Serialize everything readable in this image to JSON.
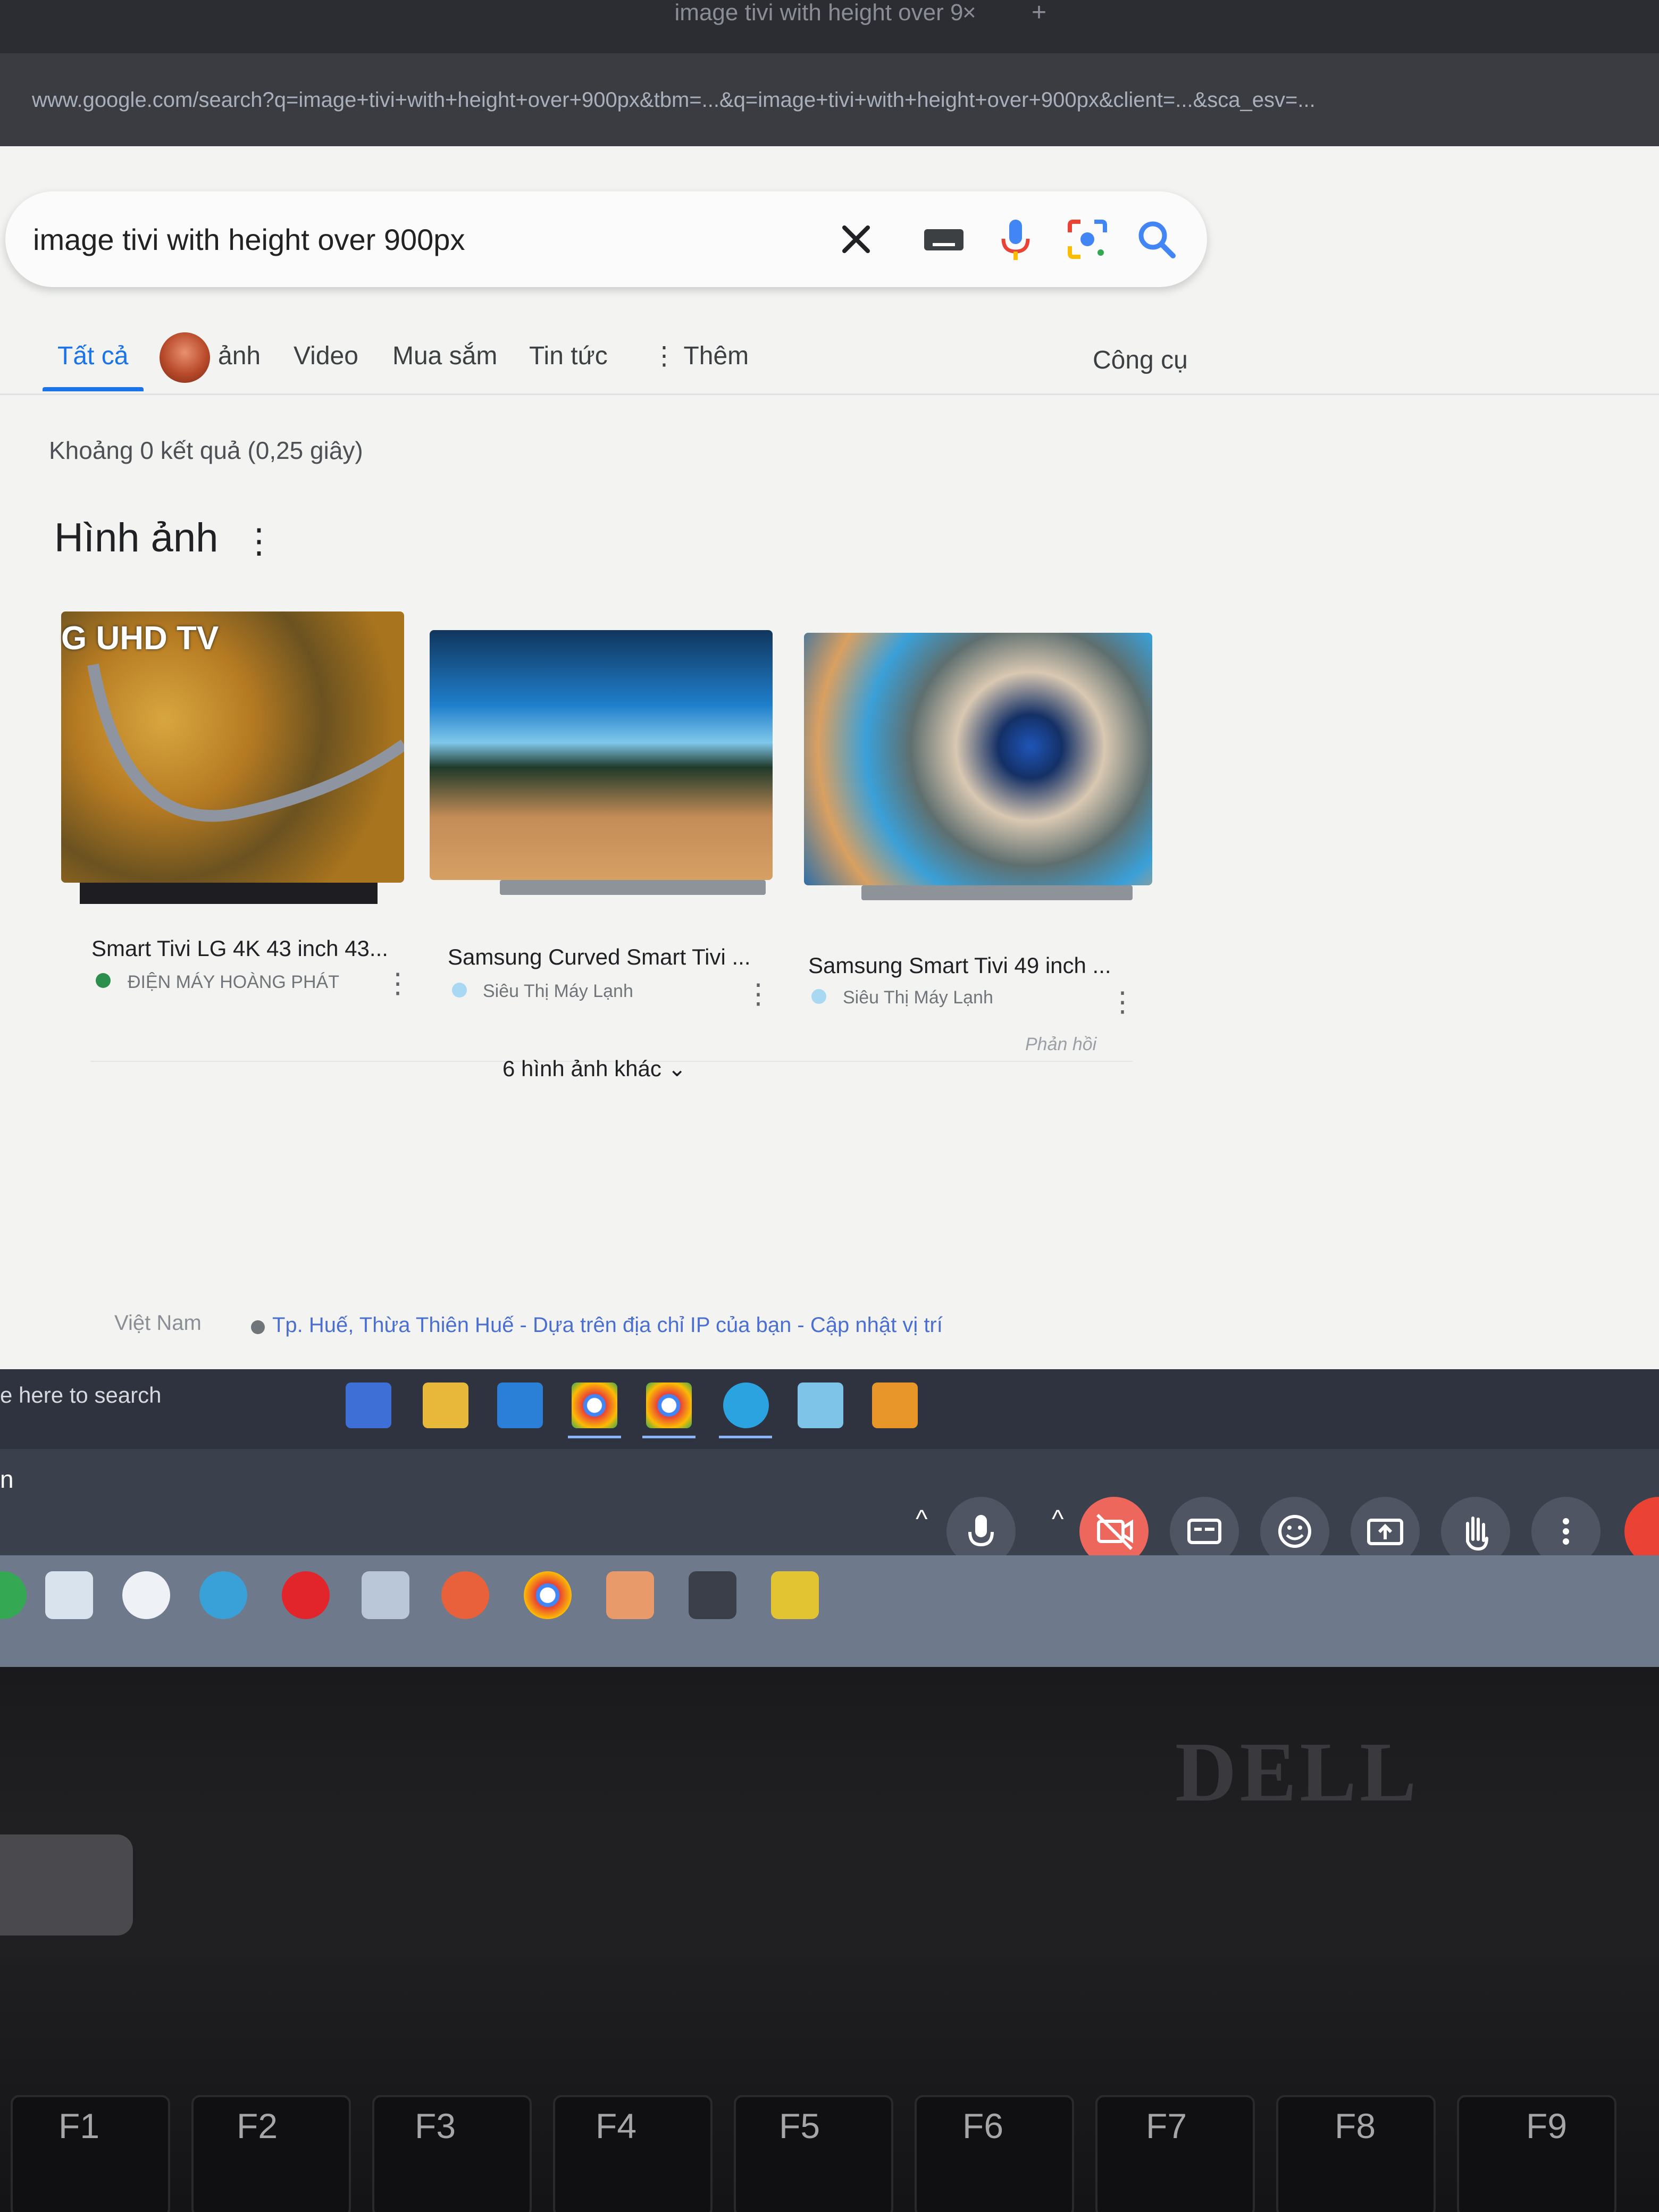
{
  "browser": {
    "tab_title": "image tivi with height over 9",
    "tab_close": "×",
    "new_tab": "+",
    "url": "www.google.com/search?q=image+tivi+with+height+over+900px&tbm=...&q=image+tivi+with+height+over+900px&client=...&sca_esv=..."
  },
  "search": {
    "query": "image tivi with height over 900px"
  },
  "tabs": {
    "all": "Tất cả",
    "images": "ảnh",
    "video": "Video",
    "shopping": "Mua sắm",
    "news": "Tin tức",
    "more": "⋮ Thêm",
    "tools": "Công cụ"
  },
  "results": {
    "stats": "Khoảng 0 kết quả (0,25 giây)",
    "images_heading": "Hình ảnh",
    "images_menu": "⋮",
    "cards": [
      {
        "overlay": "G UHD TV",
        "title": "Smart Tivi LG 4K 43 inch 43...",
        "source": "ĐIỆN MÁY HOÀNG PHÁT",
        "menu": "⋮"
      },
      {
        "title": "Samsung Curved Smart Tivi ...",
        "source": "Siêu Thị Máy Lạnh",
        "menu": "⋮"
      },
      {
        "title": "Samsung Smart Tivi 49 inch ...",
        "source": "Siêu Thị Máy Lạnh",
        "menu": "⋮"
      }
    ],
    "feedback": "Phản hồi",
    "more_images": "6 hình ảnh khác ⌄"
  },
  "footer": {
    "country": "Việt Nam",
    "location": "Tp. Huế, Thừa Thiên Huế - Dựa trên địa chỉ IP của bạn - Cập nhật vị trí"
  },
  "taskbar": {
    "search_text": "e here to search"
  },
  "meeting": {
    "label": "n",
    "chevron": "^"
  },
  "laptop": {
    "brand": "DELL",
    "fkeys": [
      "F1",
      "F2",
      "F3",
      "F4",
      "F5",
      "F6",
      "F7",
      "F8",
      "F9"
    ]
  },
  "colors": {
    "accent": "#1a73e8",
    "mic_blue": "#4285f4",
    "mic_red": "#ea4335",
    "camera_off": "#ee675c"
  }
}
